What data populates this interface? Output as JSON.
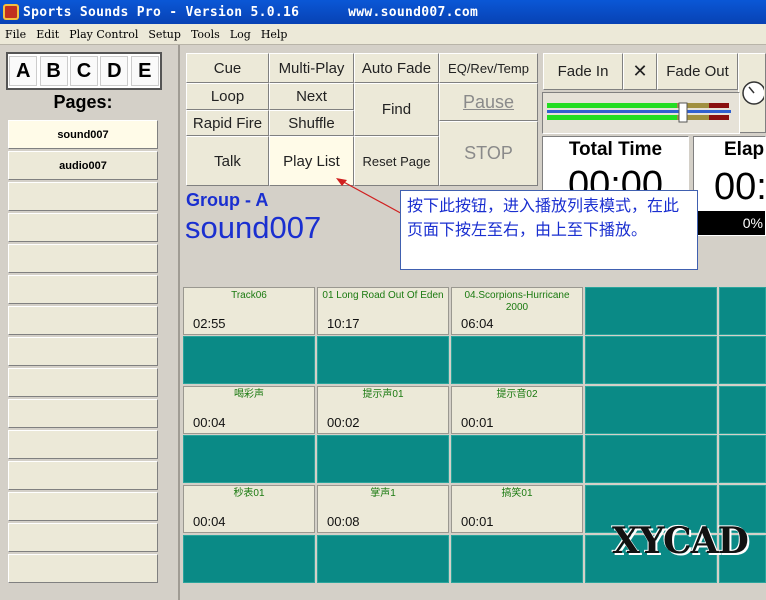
{
  "window": {
    "title": "Sports Sounds Pro - Version 5.0.16      www.sound007.com"
  },
  "menu": [
    "File",
    "Edit",
    "Play Control",
    "Setup",
    "Tools",
    "Log",
    "Help"
  ],
  "bank_letters": [
    "A",
    "B",
    "C",
    "D",
    "E"
  ],
  "pages_label": "Pages:",
  "pages": [
    "sound007",
    "audio007"
  ],
  "buttons": {
    "cue": "Cue",
    "multi_play": "Multi-Play",
    "auto_fade": "Auto Fade",
    "eq": "EQ/Rev/Temp",
    "loop": "Loop",
    "next": "Next",
    "find": "Find",
    "pause": "Pause",
    "rapid_fire": "Rapid Fire",
    "shuffle": "Shuffle",
    "talk": "Talk",
    "play_list": "Play List",
    "reset_page": "Reset Page",
    "stop": "STOP",
    "fade_in": "Fade In",
    "close": "✕",
    "fade_out": "Fade Out"
  },
  "group": {
    "label": "Group - A",
    "name": "sound007"
  },
  "total_time": {
    "label": "Total Time",
    "value": "00:00"
  },
  "elapsed": {
    "label": "Elap",
    "value": "00:",
    "percent": "0%"
  },
  "callout": "按下此按钮，进入播放列表模式，在此页面下按左至右，由上至下播放。",
  "tracks": [
    {
      "name": "Track06",
      "duration": "02:55"
    },
    {
      "name": "01 Long Road Out Of Eden",
      "duration": "10:17"
    },
    {
      "name": "04.Scorpions-Hurricane 2000",
      "duration": "06:04"
    },
    {
      "name": "喝彩声",
      "duration": "00:04"
    },
    {
      "name": "提示声01",
      "duration": "00:02"
    },
    {
      "name": "提示音02",
      "duration": "00:01"
    },
    {
      "name": "秒表01",
      "duration": "00:04"
    },
    {
      "name": "掌声1",
      "duration": "00:08"
    },
    {
      "name": "搞笑01",
      "duration": "00:01"
    }
  ],
  "watermark": "XYCAD",
  "colors": {
    "title_bar": "#0842b4",
    "grid_empty": "#0a8a86",
    "group_text": "#1a2fd0",
    "track_name": "#1a7a10"
  }
}
